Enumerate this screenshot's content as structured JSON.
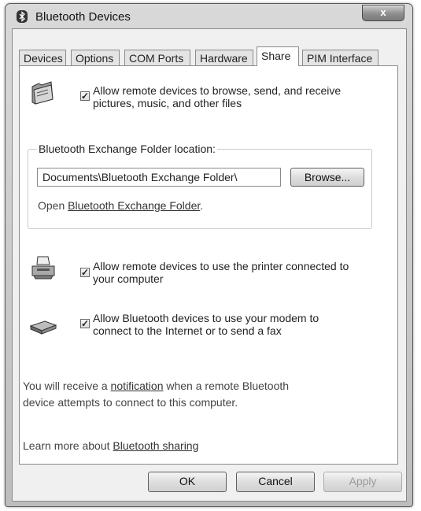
{
  "window": {
    "title": "Bluetooth Devices",
    "close_label": "x"
  },
  "tabs": [
    {
      "label": "Devices"
    },
    {
      "label": "Options"
    },
    {
      "label": "COM Ports"
    },
    {
      "label": "Hardware"
    },
    {
      "label": "Share",
      "active": true
    },
    {
      "label": "PIM Interface"
    }
  ],
  "share": {
    "allow_files": {
      "checked": true,
      "line1": "Allow remote devices to browse, send, and receive",
      "line2": "pictures, music, and other files"
    },
    "exchange_folder": {
      "group_label": "Bluetooth Exchange Folder location:",
      "path_value": "Documents\\Bluetooth Exchange Folder\\",
      "browse_label": "Browse...",
      "open_prefix": "Open ",
      "open_link": "Bluetooth Exchange Folder",
      "open_suffix": "."
    },
    "allow_printer": {
      "checked": true,
      "line1": "Allow remote devices to use the printer connected to",
      "line2": "your computer"
    },
    "allow_modem": {
      "checked": true,
      "line1": "Allow Bluetooth devices to use your modem to",
      "line2": "connect to the Internet or to send a fax"
    },
    "notification": {
      "prefix": "You will receive a ",
      "link": "notification",
      "suffix": " when a remote Bluetooth",
      "line2": "device attempts to connect to this computer."
    },
    "learn_more": {
      "prefix": "Learn more about ",
      "link": "Bluetooth sharing"
    }
  },
  "buttons": {
    "ok": "OK",
    "cancel": "Cancel",
    "apply": "Apply"
  },
  "icons": {
    "title": "bluetooth-icon",
    "files": "folder-icon",
    "printer": "printer-icon",
    "modem": "modem-icon"
  }
}
